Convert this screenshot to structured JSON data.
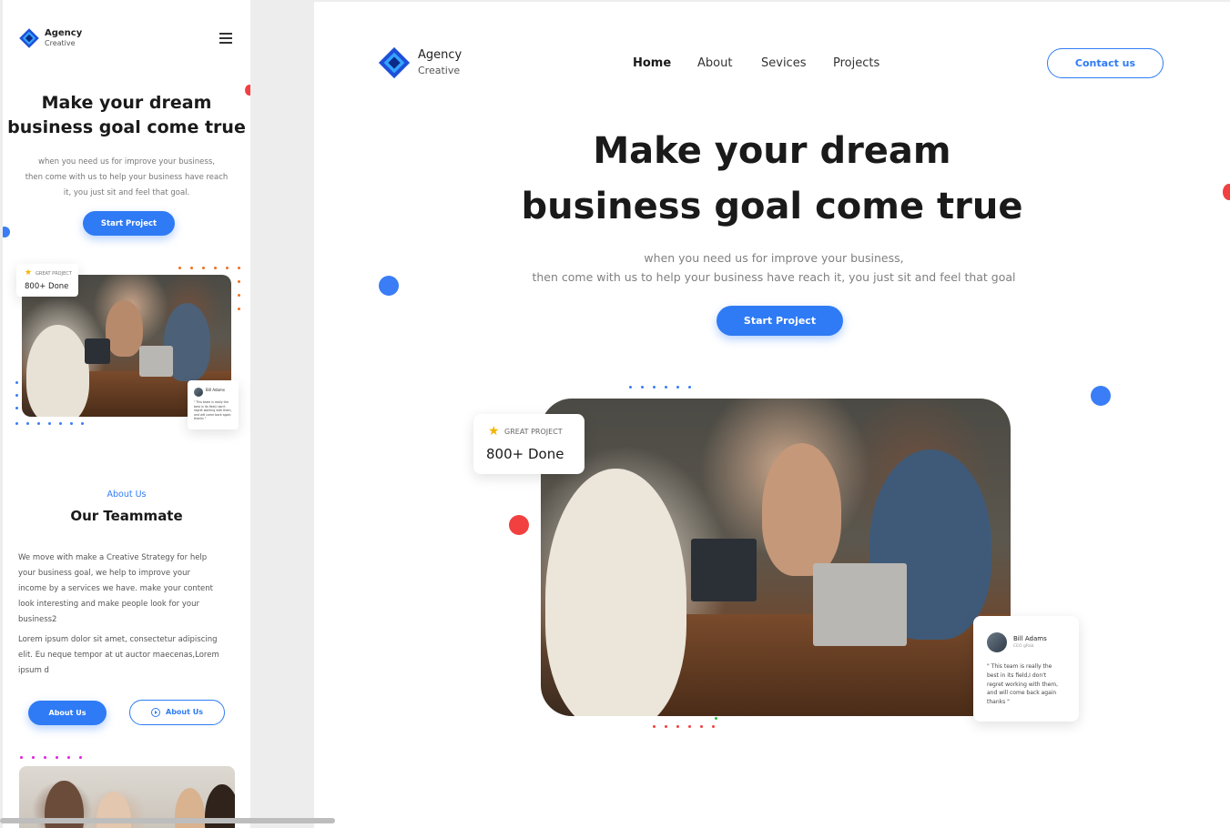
{
  "brand": {
    "name": "Agency",
    "tagline": "Creative"
  },
  "colors": {
    "accent": "#2f7bf5",
    "red_dot": "#f24040",
    "orange_dot": "#f07020",
    "magenta_dot": "#e020e0",
    "green_dot": "#20c040"
  },
  "nav": {
    "home": "Home",
    "about": "About",
    "services": "Sevices",
    "projects": "Projects",
    "contact": "Contact us",
    "menu_icon": "hamburger-menu-icon"
  },
  "hero": {
    "title_line1": "Make your dream",
    "title_line2": "business goal come true",
    "subtitle_line1": "when you need us for improve your business,",
    "subtitle_line2": "then come with us to help your business have reach it, you just sit and feel that goal",
    "mobile_sub_line1": "when you need us for improve your business,",
    "mobile_sub_line2": "then come with us to help your business have reach",
    "mobile_sub_line3": "it, you just sit and feel that goal.",
    "cta": "Start Project"
  },
  "badge": {
    "label": "GREAT PROJECT",
    "value": "800+ Done",
    "icon": "star-icon"
  },
  "testimonial": {
    "name": "Bill Adams",
    "role": "CEO gRab",
    "quote_line1": "\" This team is really the",
    "quote_line2": "best in its field,I don't",
    "quote_line3": "regret working with them,",
    "quote_line4": "and will come back again",
    "quote_line5": "thanks \""
  },
  "about": {
    "eyebrow": "About Us",
    "title": "Our Teammate",
    "para1_l1": "We move with make a Creative Strategy for help",
    "para1_l2": "your business goal, we help to improve your",
    "para1_l3": "income by a services we have. make your content",
    "para1_l4": "look interesting and make people look for your",
    "para1_l5": "business2",
    "para2_l1": "Lorem ipsum dolor sit amet, consectetur adipiscing",
    "para2_l2": "elit. Eu neque tempor at ut auctor maecenas,Lorem",
    "para2_l3": "ipsum d",
    "btn_primary": "About Us",
    "btn_secondary": "About Us",
    "btn_secondary_icon": "play-circle-icon"
  }
}
